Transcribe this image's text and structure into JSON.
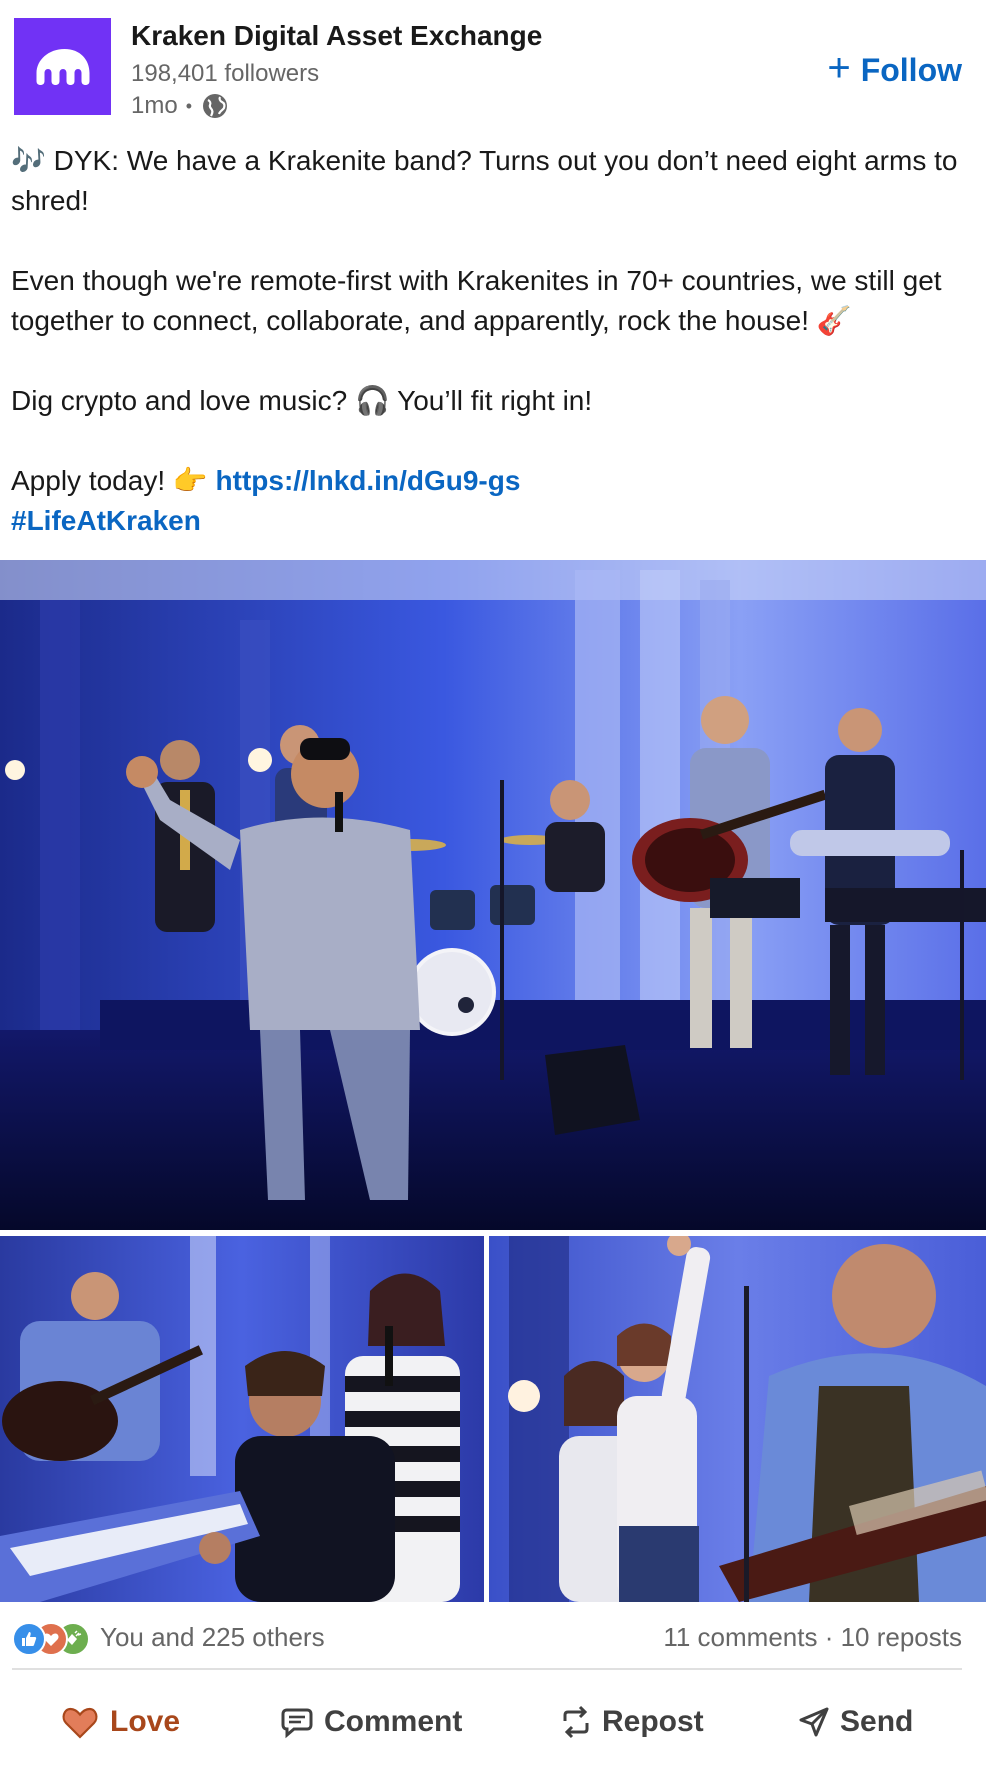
{
  "company": {
    "name": "Kraken Digital Asset Exchange",
    "followers": "198,401 followers",
    "time": "1mo",
    "visibility_icon": "globe-icon",
    "brand_color": "#7132f5"
  },
  "follow": {
    "plus": "+",
    "label": "Follow"
  },
  "post": {
    "line1_emoji": "🎶",
    "line1": " DYK: We have a Krakenite band? Turns out you don’t need eight arms to shred!",
    "line2": "Even though we're remote-first with Krakenites in 70+ countries, we still get together to connect, collaborate, and apparently, rock the house! ",
    "line2_emoji": "🎸",
    "line3": "Dig crypto and love music? ",
    "line3_emoji": "🎧",
    "line3_end": " You’ll fit right in!",
    "line4": "Apply today! ",
    "line4_emoji": "👉",
    "link": "https://lnkd.in/dGu9-gs",
    "hashtag": "#LifeAtKraken"
  },
  "images": {
    "main_alt": "Band performing on a blue-lit stage",
    "left_alt": "Keyboard player, guitarist and singer",
    "right_alt": "Singers cheering and bass player"
  },
  "social": {
    "reactions": [
      "like-icon",
      "love-icon",
      "celebrate-icon"
    ],
    "likes": "You and 225 others",
    "counts": "11 comments · 10 reposts"
  },
  "actions": {
    "love": "Love",
    "comment": "Comment",
    "repost": "Repost",
    "send": "Send"
  },
  "colors": {
    "link": "#0a66c2",
    "love": "#a8471b",
    "muted": "#666666"
  }
}
